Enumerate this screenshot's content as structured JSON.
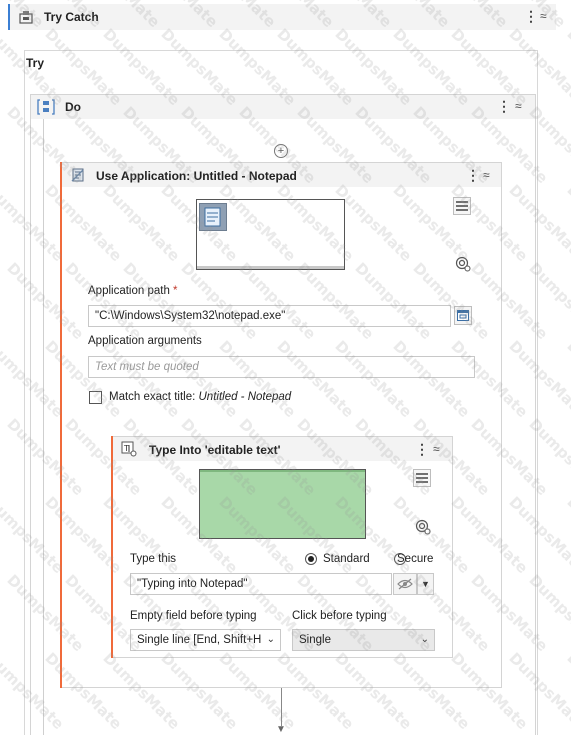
{
  "try_catch": {
    "title": "Try Catch"
  },
  "try_section": {
    "label": "Try"
  },
  "do_sequence": {
    "title": "Do"
  },
  "use_application": {
    "title": "Use Application: Untitled - Notepad",
    "app_path_label": "Application path",
    "app_path_required": "*",
    "app_path_value": "\"C:\\Windows\\System32\\notepad.exe\"",
    "app_args_label": "Application arguments",
    "app_args_placeholder": "Text must be quoted",
    "match_title_prefix": "Match exact title:",
    "match_title_value": "Untitled - Notepad"
  },
  "type_into": {
    "title": "Type Into 'editable text'",
    "type_this_label": "Type this",
    "mode_standard": "Standard",
    "mode_secure": "Secure",
    "type_this_value": "\"Typing into Notepad\"",
    "empty_field_label": "Empty field before typing",
    "empty_field_value": "Single line [End, Shift+H",
    "click_before_label": "Click before typing",
    "click_before_value": "Single"
  },
  "watermark": {
    "text": "DumpsMate"
  },
  "colors": {
    "accent": "#f06a3a",
    "screenshot_green": "#a8d8a8"
  },
  "icons": [
    "try-catch-icon",
    "sequence-icon",
    "use-application-icon",
    "type-into-icon",
    "hamburger-icon",
    "target-icon",
    "eye-off-icon",
    "expand-arrow-icon",
    "add-icon",
    "arrow-down-icon"
  ]
}
